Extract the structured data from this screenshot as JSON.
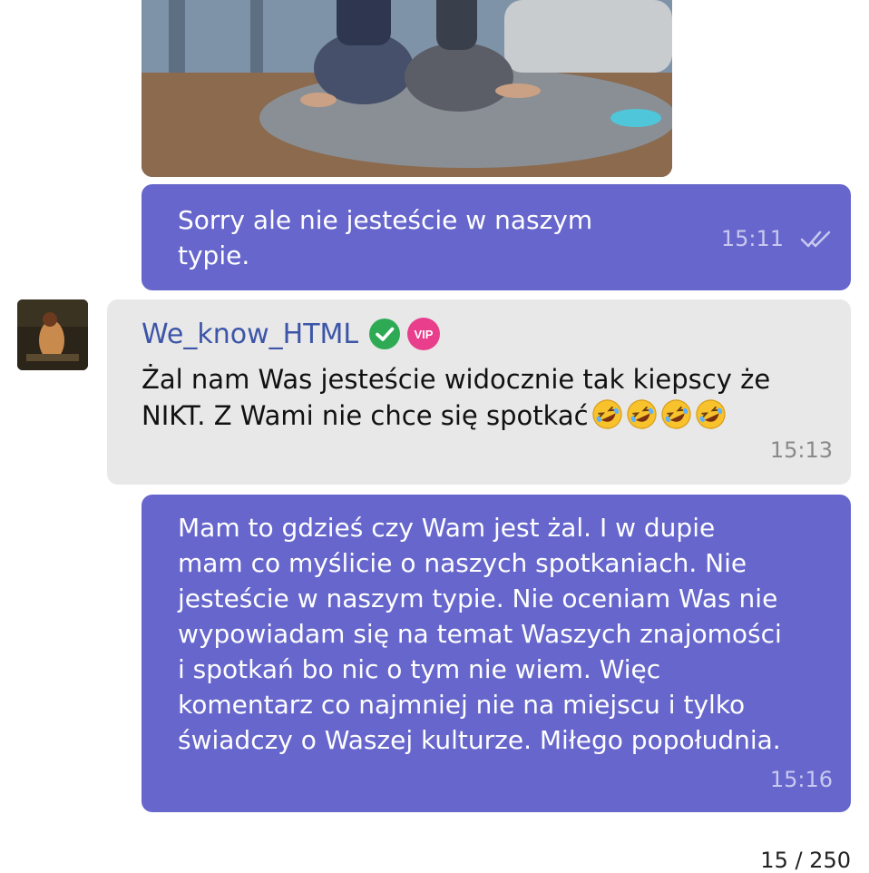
{
  "messages": [
    {
      "direction": "outgoing",
      "type": "photo",
      "content_hint": "photo of two people sitting on floor"
    },
    {
      "direction": "outgoing",
      "text": "Sorry ale nie jesteście w naszym\ntypie.",
      "time": "15:11",
      "status": "read",
      "status_icon": "double-check-icon"
    },
    {
      "direction": "incoming",
      "sender": "We_know_HTML",
      "badges": [
        "verified-icon",
        "vip-icon"
      ],
      "vip_label": "VIP",
      "text": "Żal nam Was jesteście widocznie tak kiepscy że\nNIKT. Z Wami nie chce się spotkać",
      "emoji": [
        "rofl",
        "rofl",
        "rofl",
        "rofl"
      ],
      "time": "15:13"
    },
    {
      "direction": "outgoing",
      "text": "Mam to gdzieś czy Wam jest żal. I w dupie\nmam co myślicie o naszych spotkaniach. Nie\njesteście w naszym typie. Nie oceniam Was nie\nwypowiadam się na temat Waszych znajomości\ni spotkań bo nic o tym nie wiem. Więc\nkomentarz co najmniej nie na miejscu i tylko\nświadczy o Waszej kulturze. Miłego popołudnia.",
      "time": "15:16"
    }
  ],
  "page_counter": "15 / 250",
  "colors": {
    "outgoing_bubble": "#6666cc",
    "incoming_bubble": "#e8e8e8",
    "sender_name": "#3d55a8",
    "verified_badge": "#2eaa55",
    "vip_badge": "#e83e8c"
  }
}
